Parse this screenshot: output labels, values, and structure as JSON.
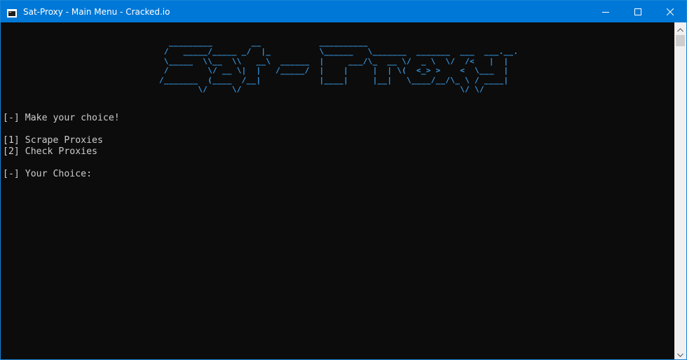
{
  "window": {
    "title": "Sat-Proxy - Main Menu - Cracked.io"
  },
  "icons": {
    "app": "console-window-icon",
    "minimize": "minimize-icon",
    "maximize": "maximize-icon",
    "close": "close-icon",
    "scroll_up": "chevron-up-icon",
    "scroll_down": "chevron-down-icon"
  },
  "colors": {
    "titlebar": "#0078d7",
    "console_bg": "#0c0c0c",
    "console_text": "#cccccc",
    "banner": "#3a96dd"
  },
  "console": {
    "banner": "  _________        __            __________                                 \n /   _____/_____ _/  |_          \\______   \\_______  _______  ___  ___.__. \n \\_____  \\\\__  \\\\   __\\  ______  |     ___/\\_  __ \\/  _ \\  \\/  /<   |  | \n /        \\/ __ \\|  |   /_____/  |    |     |  | \\(  <_> >    <  \\___  | \n/_______  (____  /__|            |____|     |__|   \\____/__/\\_ \\ / ____| \n        \\/     \\/                                             \\/ \\/      ",
    "prompt_header": "[-] Make your choice!",
    "options": [
      "[1] Scrape Proxies",
      "[2] Check Proxies"
    ],
    "input_prompt": "[-] Your Choice: "
  }
}
